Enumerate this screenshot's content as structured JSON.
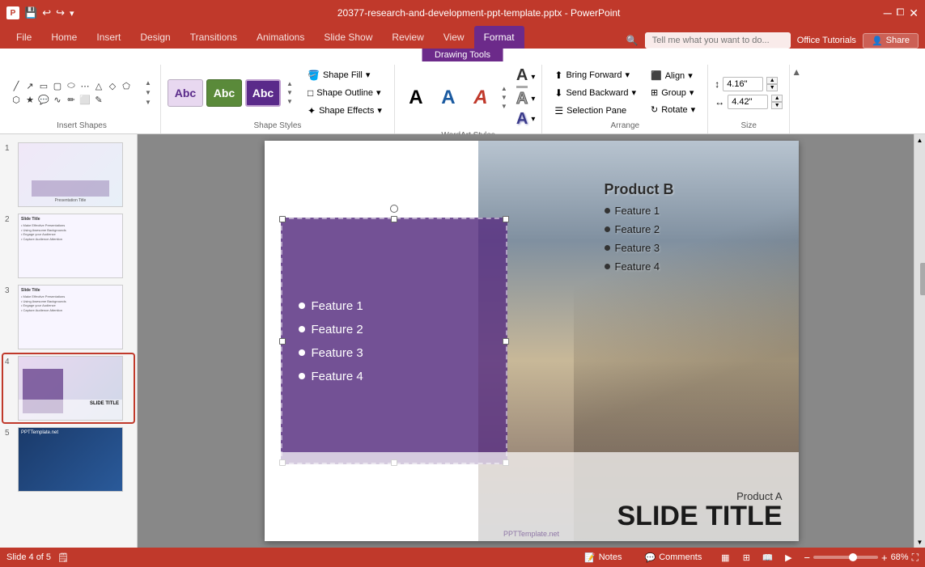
{
  "titleBar": {
    "title": "20377-research-and-development-ppt-template.pptx - PowerPoint",
    "appName": "PowerPoint",
    "contextTab": "Drawing Tools"
  },
  "menuTabs": {
    "items": [
      "File",
      "Home",
      "Insert",
      "Design",
      "Transitions",
      "Animations",
      "Slide Show",
      "Review",
      "View",
      "Format"
    ],
    "active": "Format"
  },
  "ribbon": {
    "drawingToolsLabel": "Drawing Tools",
    "sections": {
      "insertShapes": {
        "label": "Insert Shapes"
      },
      "shapeStyles": {
        "label": "Shape Styles"
      },
      "wordArtStyles": {
        "label": "WordArt Styles"
      },
      "arrange": {
        "label": "Arrange"
      },
      "size": {
        "label": "Size"
      }
    },
    "shapeFill": "Shape Fill",
    "shapeOutline": "Shape Outline",
    "shapeEffects": "Shape Effects",
    "bringForward": "Bring Forward",
    "sendBackward": "Send Backward",
    "selectionPane": "Selection Pane",
    "align": "Align",
    "group": "Group",
    "rotate": "Rotate",
    "sizeWidth": "4.16\"",
    "sizeHeight": "4.42\""
  },
  "search": {
    "placeholder": "Tell me what you want to do..."
  },
  "officeLink": "Office Tutorials",
  "share": "Share",
  "shapeStyleItems": [
    {
      "label": "Abc",
      "bg": "#e8d8f0",
      "color": "#5a2a8a"
    },
    {
      "label": "Abc",
      "bg": "#5a8a3a",
      "color": "white"
    },
    {
      "label": "Abc",
      "bg": "#5a2a8a",
      "color": "white"
    }
  ],
  "wordArtItems": [
    {
      "char": "A",
      "style": "plain"
    },
    {
      "char": "A",
      "style": "blue"
    },
    {
      "char": "A",
      "style": "red"
    }
  ],
  "slidePanel": {
    "slides": [
      {
        "num": "1",
        "active": false,
        "type": "title"
      },
      {
        "num": "2",
        "active": false,
        "type": "content"
      },
      {
        "num": "3",
        "active": false,
        "type": "content"
      },
      {
        "num": "4",
        "active": true,
        "type": "comparison"
      },
      {
        "num": "5",
        "active": false,
        "type": "blue"
      }
    ]
  },
  "slide": {
    "productBoxFeatures": [
      "Feature 1",
      "Feature 2",
      "Feature 3",
      "Feature 4"
    ],
    "productBTitle": "Product B",
    "productBFeatures": [
      "Feature 1",
      "Feature 2",
      "Feature 3",
      "Feature 4"
    ],
    "productALabel": "Product A",
    "slideTitle": "SLIDE TITLE",
    "watermark": "PPTTemplate.net"
  },
  "statusBar": {
    "slideInfo": "Slide 4 of 5",
    "notes": "Notes",
    "comments": "Comments",
    "zoom": "68%"
  }
}
